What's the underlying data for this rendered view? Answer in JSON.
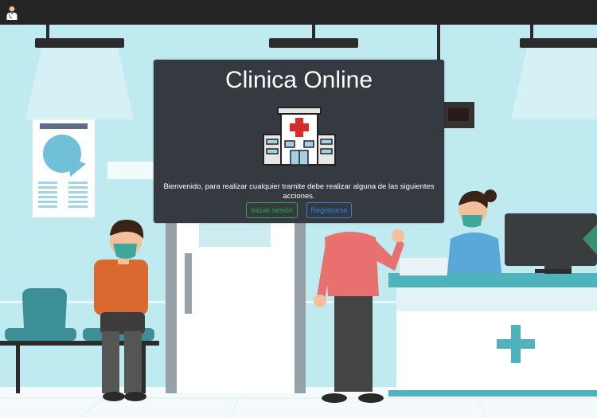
{
  "app": {
    "title": "Clinica Online",
    "welcome": "Bienvenido, para realizar cualquier tramite debe realizar alguna de las siguientes acciones.",
    "login_label": "Iniciar sesión",
    "register_label": "Registrarse"
  },
  "icons": {
    "topbar": "doctor-icon",
    "card": "hospital-icon"
  },
  "colors": {
    "topbar": "#242424",
    "card": "#343a40",
    "login": "#28a745",
    "register": "#2f7fe0",
    "wall": "#bfeaf0"
  }
}
